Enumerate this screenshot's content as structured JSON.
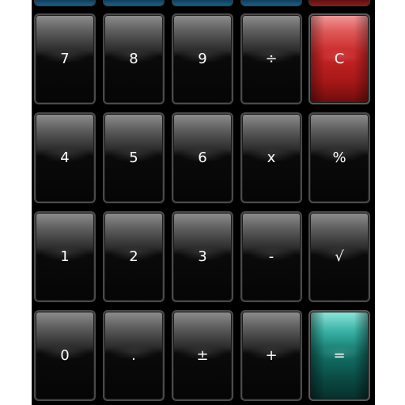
{
  "keypad": {
    "rows": [
      [
        {
          "label": "7"
        },
        {
          "label": "8"
        },
        {
          "label": "9"
        },
        {
          "label": "÷"
        },
        {
          "label": "C"
        }
      ],
      [
        {
          "label": "4"
        },
        {
          "label": "5"
        },
        {
          "label": "6"
        },
        {
          "label": "x"
        },
        {
          "label": "%"
        }
      ],
      [
        {
          "label": "1"
        },
        {
          "label": "2"
        },
        {
          "label": "3"
        },
        {
          "label": "-"
        },
        {
          "label": "√"
        }
      ],
      [
        {
          "label": "0"
        },
        {
          "label": "."
        },
        {
          "label": "±"
        },
        {
          "label": "+"
        },
        {
          "label": "="
        }
      ]
    ]
  },
  "colors": {
    "background": "#000000",
    "clear_key": "#c82424",
    "equals_key": "#127267",
    "top_strip_blue": "#1a5f86",
    "top_strip_red": "#8a1a1a"
  }
}
